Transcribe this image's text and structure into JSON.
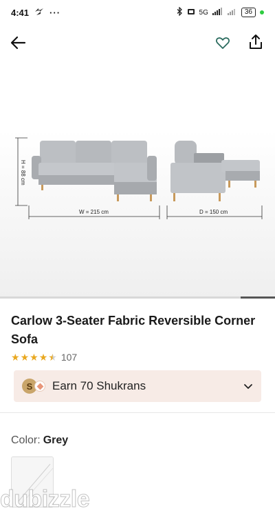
{
  "status_bar": {
    "time": "4:41",
    "dots": "···",
    "network": "5G",
    "battery": "36"
  },
  "icons": {
    "back": "arrow-left-icon",
    "favorite": "heart-outline-icon",
    "share": "share-upload-icon"
  },
  "hero": {
    "height_label": "H = 88 cm",
    "width_label": "W = 215 cm",
    "depth_label": "D = 150 cm"
  },
  "product": {
    "title": "Carlow 3-Seater Fabric Reversible Corner Sofa",
    "rating_stars": 4.5,
    "rating_count": "107"
  },
  "shukran": {
    "badge_letter": "S",
    "text": "Earn 70 Shukrans"
  },
  "color": {
    "label": "Color:",
    "value": "Grey"
  },
  "watermark": {
    "text": "dubizzle"
  },
  "colors": {
    "accent_star": "#e9a820",
    "shukran_bg": "#f7ebe6",
    "sofa_grey": "#b9bcc0"
  }
}
